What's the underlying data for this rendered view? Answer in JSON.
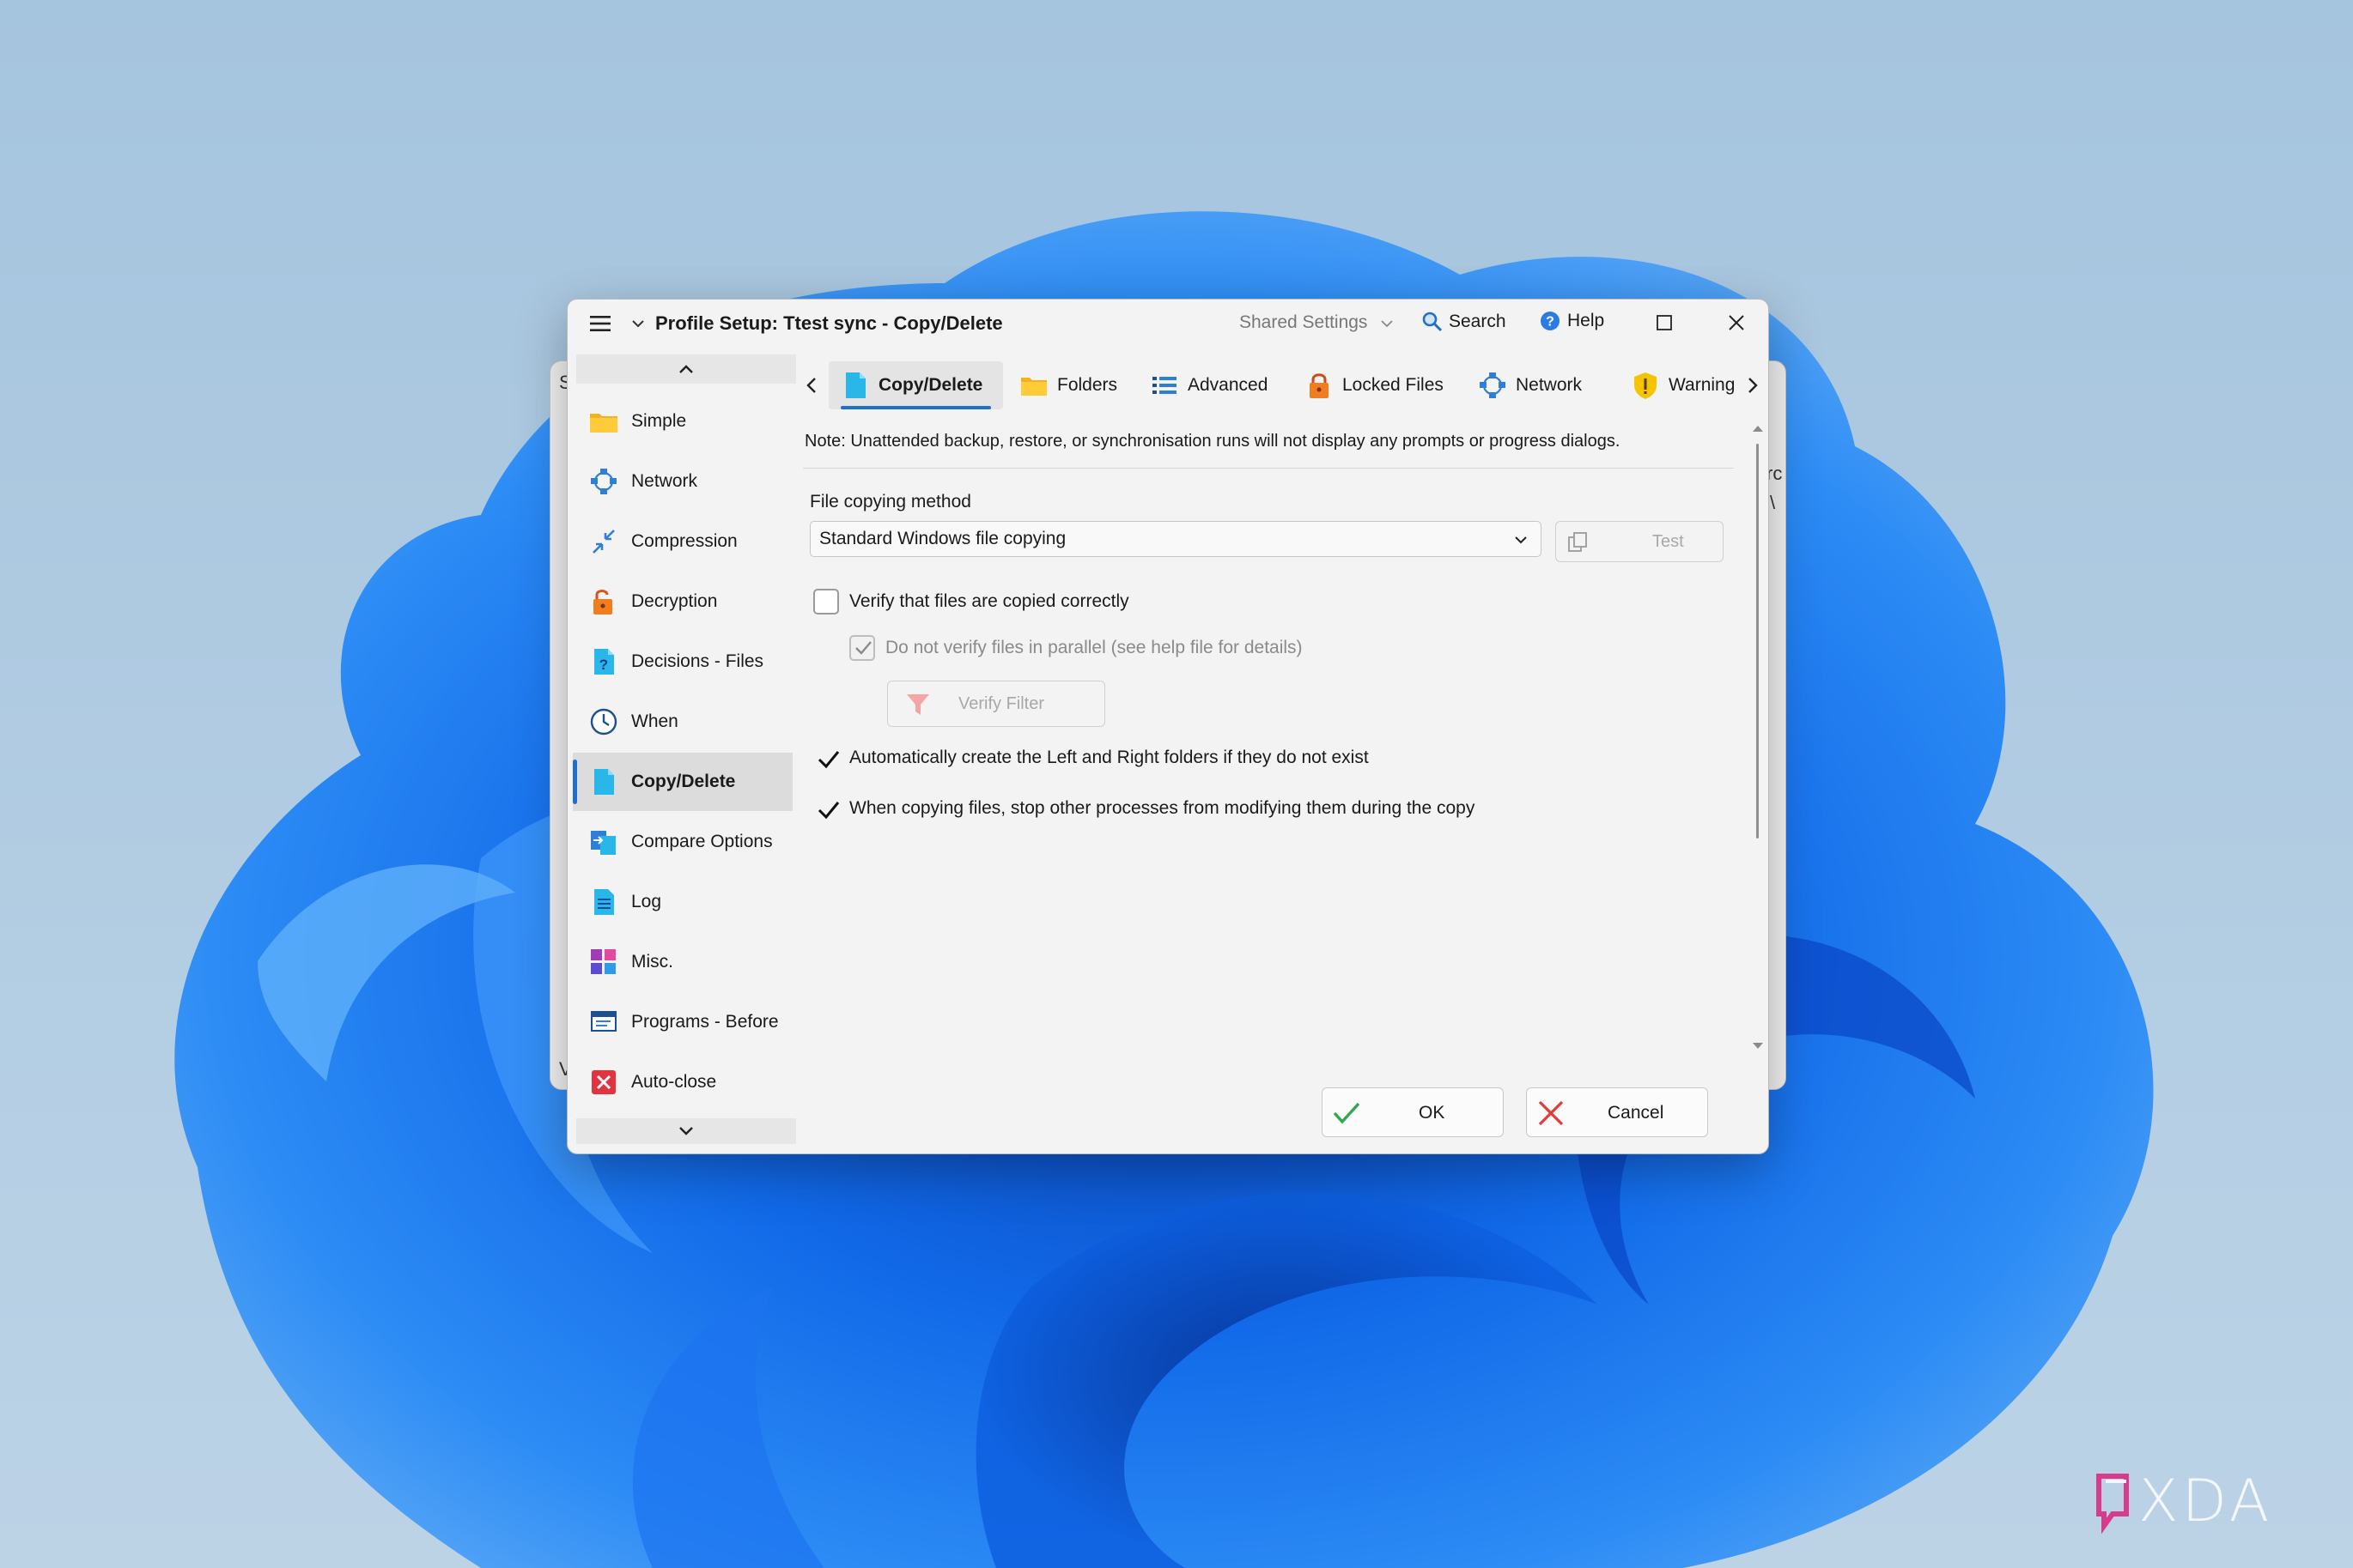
{
  "window": {
    "title": "Profile Setup: Ttest sync - Copy/Delete",
    "shared_settings": "Shared Settings",
    "search": "Search",
    "help": "Help"
  },
  "background_window": {
    "peek_letters": [
      "S",
      "rc",
      "\\",
      "V"
    ]
  },
  "sidebar": {
    "items": [
      {
        "label": "Simple",
        "icon": "folder-icon"
      },
      {
        "label": "Network",
        "icon": "network-icon"
      },
      {
        "label": "Compression",
        "icon": "compression-icon"
      },
      {
        "label": "Decryption",
        "icon": "unlocked-padlock-icon"
      },
      {
        "label": "Decisions - Files",
        "icon": "question-file-icon"
      },
      {
        "label": "When",
        "icon": "clock-icon"
      },
      {
        "label": "Copy/Delete",
        "icon": "document-icon",
        "active": true
      },
      {
        "label": "Compare Options",
        "icon": "compare-icon"
      },
      {
        "label": "Log",
        "icon": "log-icon"
      },
      {
        "label": "Misc.",
        "icon": "misc-tiles-icon"
      },
      {
        "label": "Programs - Before",
        "icon": "programs-icon"
      },
      {
        "label": "Auto-close",
        "icon": "auto-close-icon"
      }
    ]
  },
  "tabs": [
    {
      "label": "Copy/Delete",
      "icon": "document-icon",
      "active": true
    },
    {
      "label": "Folders",
      "icon": "folder-icon"
    },
    {
      "label": "Advanced",
      "icon": "list-icon"
    },
    {
      "label": "Locked Files",
      "icon": "padlock-icon"
    },
    {
      "label": "Network",
      "icon": "network-icon"
    },
    {
      "label": "Warning",
      "icon": "warning-shield-icon"
    }
  ],
  "content": {
    "note": "Note: Unattended backup, restore, or synchronisation runs will not display any prompts or progress dialogs.",
    "file_copying_method_label": "File copying method",
    "file_copying_method_value": "Standard Windows file copying",
    "test_button": "Test",
    "verify_label": "Verify that files are copied correctly",
    "verify_checked": false,
    "parallel_label": "Do not verify files in parallel (see help file for details)",
    "parallel_checked": true,
    "verify_filter_button": "Verify Filter",
    "auto_create_label": "Automatically create the Left and Right folders if they do not exist",
    "auto_create_checked": true,
    "stop_processes_label": "When copying files, stop other processes from modifying them during the copy",
    "stop_processes_checked": true
  },
  "footer": {
    "ok": "OK",
    "cancel": "Cancel"
  },
  "watermark": {
    "text": "XDA"
  },
  "colors": {
    "accent": "#1f6fd1",
    "wallpaper_light": "#b5cfe4",
    "wallpaper_bloom": "#0a5bd8"
  }
}
